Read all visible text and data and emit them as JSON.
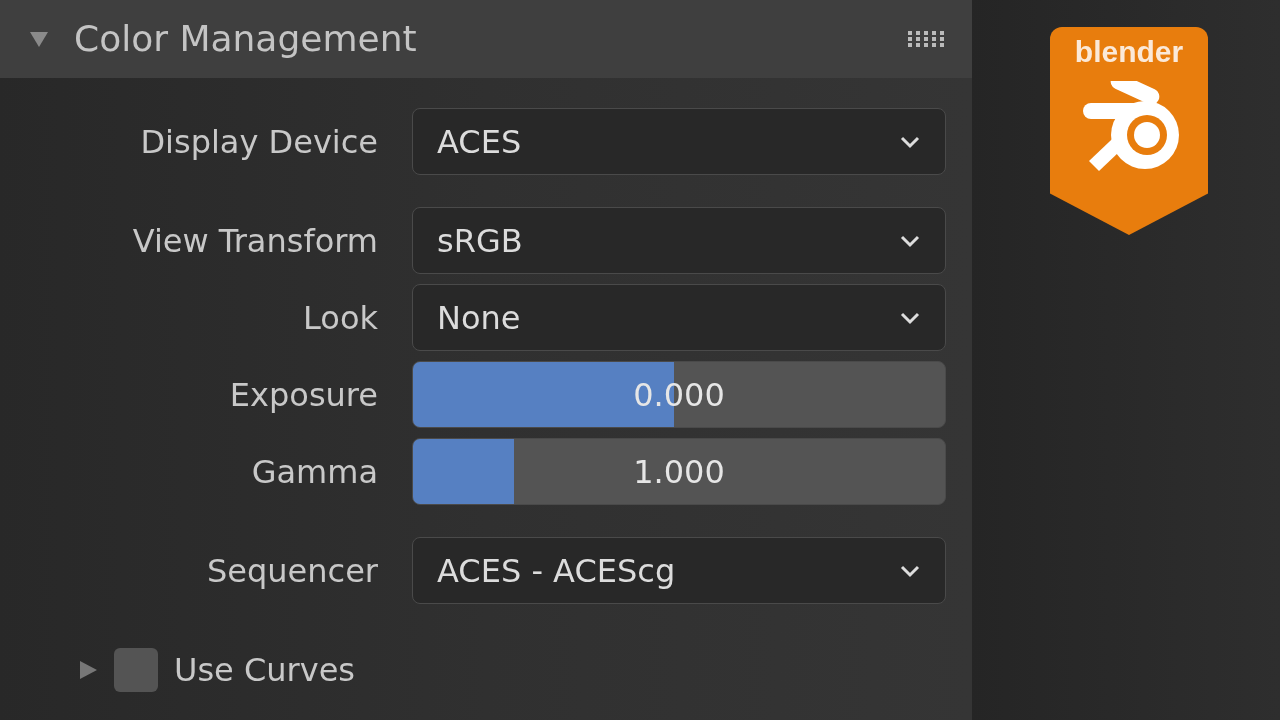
{
  "panel": {
    "title": "Color Management",
    "expanded": true
  },
  "groups": [
    [
      {
        "kind": "dropdown",
        "label": "Display Device",
        "value": "ACES"
      }
    ],
    [
      {
        "kind": "dropdown",
        "label": "View Transform",
        "value": "sRGB"
      },
      {
        "kind": "dropdown",
        "label": "Look",
        "value": "None"
      },
      {
        "kind": "slider",
        "label": "Exposure",
        "value": "0.000",
        "level": 0.49
      },
      {
        "kind": "slider",
        "label": "Gamma",
        "value": "1.000",
        "level": 0.19
      }
    ],
    [
      {
        "kind": "dropdown",
        "label": "Sequencer",
        "value": "ACES - ACEScg"
      }
    ]
  ],
  "subpanel": {
    "label": "Use Curves",
    "checked": false,
    "expanded": false
  },
  "logo": {
    "text": "blender"
  }
}
